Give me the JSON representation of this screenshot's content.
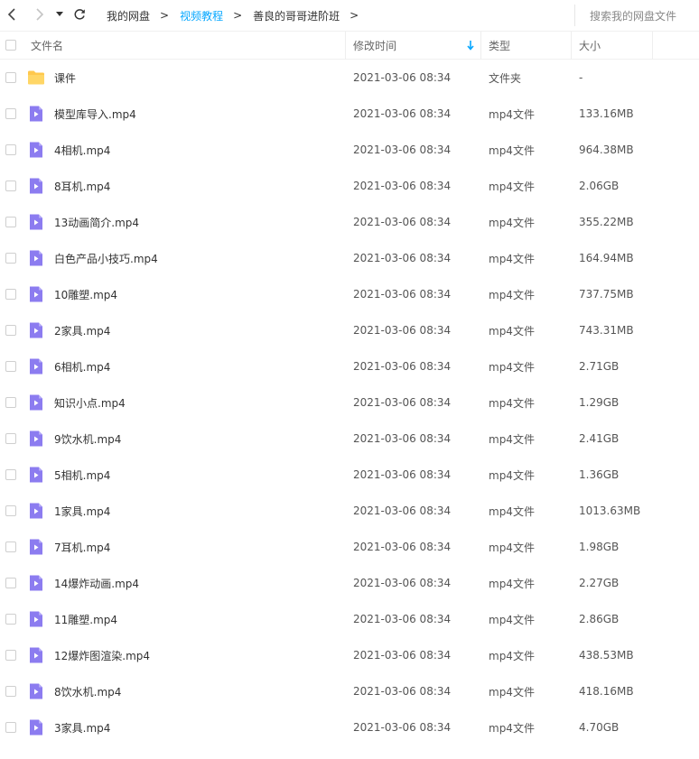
{
  "nav": {
    "back_icon": "chevron-left-icon",
    "forward_icon": "chevron-right-icon",
    "dropdown_icon": "caret-down-icon",
    "refresh_icon": "refresh-icon"
  },
  "breadcrumb": [
    {
      "label": "我的网盘",
      "link": false
    },
    {
      "label": "视频教程",
      "link": true
    },
    {
      "label": "善良的哥哥进阶班",
      "link": false
    }
  ],
  "breadcrumb_separator": ">",
  "search": {
    "placeholder": "搜索我的网盘文件"
  },
  "columns": {
    "name": "文件名",
    "modified": "修改时间",
    "type": "类型",
    "size": "大小",
    "sort_icon": "arrow-down-icon"
  },
  "colors": {
    "accent": "#06a7ff",
    "folder": "#ffc84d",
    "video": "#8c7cf0"
  },
  "files": [
    {
      "name": "课件",
      "time": "2021-03-06 08:34",
      "type": "文件夹",
      "size": "-",
      "icon": "folder-icon"
    },
    {
      "name": "模型库导入.mp4",
      "time": "2021-03-06 08:34",
      "type": "mp4文件",
      "size": "133.16MB",
      "icon": "video-file-icon"
    },
    {
      "name": "4相机.mp4",
      "time": "2021-03-06 08:34",
      "type": "mp4文件",
      "size": "964.38MB",
      "icon": "video-file-icon"
    },
    {
      "name": "8耳机.mp4",
      "time": "2021-03-06 08:34",
      "type": "mp4文件",
      "size": "2.06GB",
      "icon": "video-file-icon"
    },
    {
      "name": "13动画简介.mp4",
      "time": "2021-03-06 08:34",
      "type": "mp4文件",
      "size": "355.22MB",
      "icon": "video-file-icon"
    },
    {
      "name": "白色产品小技巧.mp4",
      "time": "2021-03-06 08:34",
      "type": "mp4文件",
      "size": "164.94MB",
      "icon": "video-file-icon"
    },
    {
      "name": "10雕塑.mp4",
      "time": "2021-03-06 08:34",
      "type": "mp4文件",
      "size": "737.75MB",
      "icon": "video-file-icon"
    },
    {
      "name": "2家具.mp4",
      "time": "2021-03-06 08:34",
      "type": "mp4文件",
      "size": "743.31MB",
      "icon": "video-file-icon"
    },
    {
      "name": "6相机.mp4",
      "time": "2021-03-06 08:34",
      "type": "mp4文件",
      "size": "2.71GB",
      "icon": "video-file-icon"
    },
    {
      "name": "知识小点.mp4",
      "time": "2021-03-06 08:34",
      "type": "mp4文件",
      "size": "1.29GB",
      "icon": "video-file-icon"
    },
    {
      "name": "9饮水机.mp4",
      "time": "2021-03-06 08:34",
      "type": "mp4文件",
      "size": "2.41GB",
      "icon": "video-file-icon"
    },
    {
      "name": "5相机.mp4",
      "time": "2021-03-06 08:34",
      "type": "mp4文件",
      "size": "1.36GB",
      "icon": "video-file-icon"
    },
    {
      "name": "1家具.mp4",
      "time": "2021-03-06 08:34",
      "type": "mp4文件",
      "size": "1013.63MB",
      "icon": "video-file-icon"
    },
    {
      "name": "7耳机.mp4",
      "time": "2021-03-06 08:34",
      "type": "mp4文件",
      "size": "1.98GB",
      "icon": "video-file-icon"
    },
    {
      "name": "14爆炸动画.mp4",
      "time": "2021-03-06 08:34",
      "type": "mp4文件",
      "size": "2.27GB",
      "icon": "video-file-icon"
    },
    {
      "name": "11雕塑.mp4",
      "time": "2021-03-06 08:34",
      "type": "mp4文件",
      "size": "2.86GB",
      "icon": "video-file-icon"
    },
    {
      "name": "12爆炸图渲染.mp4",
      "time": "2021-03-06 08:34",
      "type": "mp4文件",
      "size": "438.53MB",
      "icon": "video-file-icon"
    },
    {
      "name": "8饮水机.mp4",
      "time": "2021-03-06 08:34",
      "type": "mp4文件",
      "size": "418.16MB",
      "icon": "video-file-icon"
    },
    {
      "name": "3家具.mp4",
      "time": "2021-03-06 08:34",
      "type": "mp4文件",
      "size": "4.70GB",
      "icon": "video-file-icon"
    }
  ]
}
